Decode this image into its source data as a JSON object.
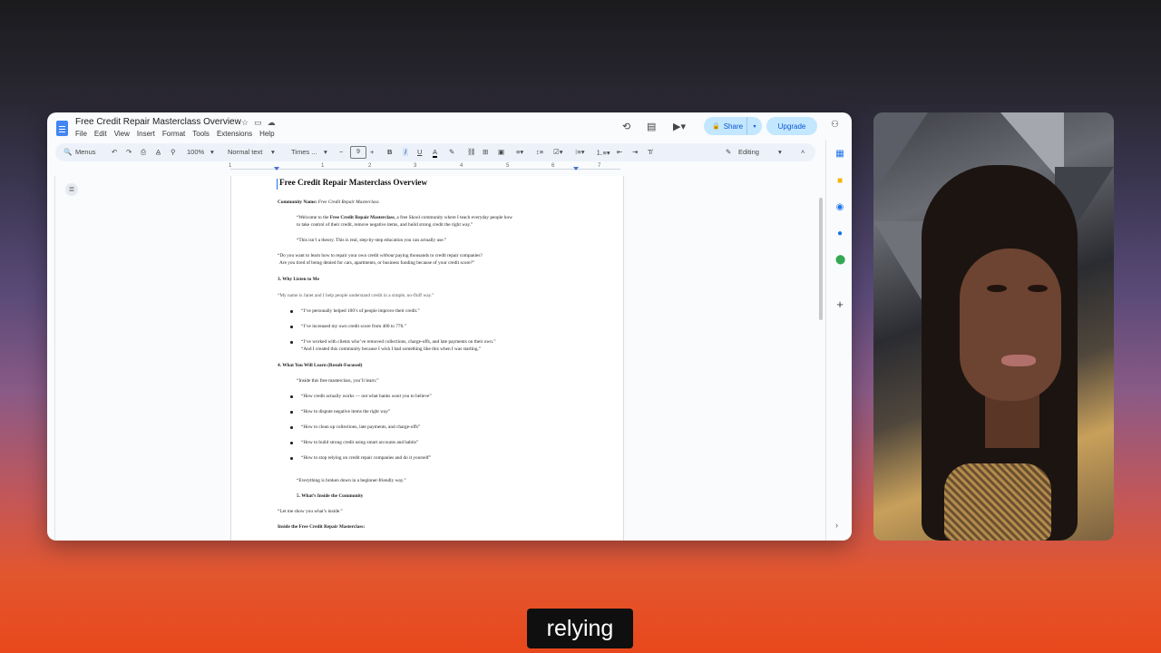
{
  "doc": {
    "title": "Free Credit Repair Masterclass Overview",
    "menus": [
      "File",
      "Edit",
      "View",
      "Insert",
      "Format",
      "Tools",
      "Extensions",
      "Help"
    ],
    "share_label": "Share",
    "upgrade_label": "Upgrade"
  },
  "toolbar": {
    "menus_label": "Menus",
    "zoom": "100%",
    "style": "Normal text",
    "font": "Times ...",
    "font_size": "9",
    "mode": "Editing"
  },
  "ruler": {
    "ticks": [
      "1",
      "1",
      "2",
      "3",
      "4",
      "5",
      "6",
      "7"
    ]
  },
  "content": {
    "heading": "Free Credit Repair Masterclass Overview",
    "community_label": "Community Name:",
    "community_value": "Free Credit Repair Masterclass",
    "welcome_pre": "“Welcome to the ",
    "welcome_bold": "Free Credit Repair Masterclass",
    "welcome_post": ", a free Skool community where I teach everyday people how",
    "welcome_line2": "to take control of their credit, remove negative items, and build strong credit the right way.”",
    "not_theory": "“This isn’t a theory. This is real, step-by-step education you can actually use.”",
    "q1_pre": "“Do you want to learn how to repair your own credit ",
    "q1_italic": "without",
    "q1_post": " paying thousands to credit repair companies?",
    "q2": "Are you tired of being denied for cars, apartments, or business funding because of your credit score?”",
    "sec3": "3. Why Listen to Me",
    "intro": "“My name is Janet  and I help people understand credit in a simple, no-fluff way.”",
    "bullets3": [
      "“I’ve personally helped 100’s of  people improve their credit.”",
      "“I’ve increased my own credit score from 400 to 770.”",
      "“I’ve worked with clients who’ve removed collections, charge-offs, and late payments on their own.”"
    ],
    "bullet3_line2": "“And I created this community because I wish I had something like this when I was starting.”",
    "sec4": "4. What You Will Learn (Result-Focused)",
    "inside_free": "“Inside this free masterclass, you’ll learn:”",
    "b4_1_pre": "“How credit actually works — not what banks ",
    "b4_1_italic": "want",
    "b4_1_post": " you to believe”",
    "bullets4": [
      "“How to dispute negative items the right way”",
      "“How to clean up collections, late payments, and charge-offs”",
      "“How to build strong credit using smart accounts and habits”",
      "“How to stop relying on credit repair companies and do it yourself”"
    ],
    "broken_down": "“Everything is broken down in a beginner-friendly way.”",
    "sec5": "5. What’s Inside the Community",
    "let_me_show": "“Let me show you what’s inside.”",
    "inside_heading": "Inside the Free Credit Repair Masterclass:"
  },
  "caption": {
    "text": "relying"
  },
  "icons": [
    "docs-logo-icon",
    "star-icon",
    "folder-icon",
    "cloud-icon",
    "history-icon",
    "comment-icon",
    "meet-icon",
    "lock-icon",
    "account-icon",
    "search-icon",
    "undo-icon",
    "redo-icon",
    "print-icon",
    "spellcheck-icon",
    "paint-format-icon",
    "bold-icon",
    "italic-icon",
    "underline-icon",
    "text-color-icon",
    "highlight-icon",
    "link-icon",
    "add-comment-icon",
    "image-icon",
    "align-icon",
    "line-spacing-icon",
    "checklist-icon",
    "bullet-list-icon",
    "numbered-list-icon",
    "indent-decrease-icon",
    "indent-increase-icon",
    "clear-format-icon",
    "pencil-icon",
    "outline-icon",
    "calendar-icon",
    "keep-icon",
    "tasks-icon",
    "contacts-icon",
    "maps-icon",
    "plus-icon"
  ]
}
